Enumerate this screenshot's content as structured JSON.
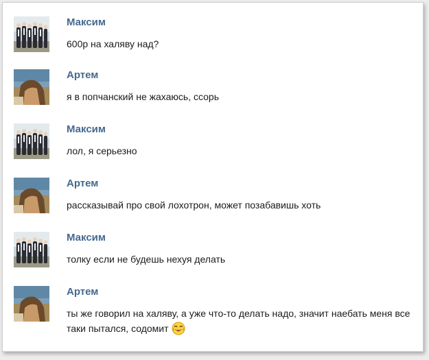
{
  "messages": [
    {
      "author": "Максим",
      "avatar_icon": "group-photo-icon",
      "text": "600р на халяву над?"
    },
    {
      "author": "Артем",
      "avatar_icon": "person-photo-icon",
      "text": "я в попчанский не жахаюсь, ссорь"
    },
    {
      "author": "Максим",
      "avatar_icon": "group-photo-icon",
      "text": "лол, я серьезно"
    },
    {
      "author": "Артем",
      "avatar_icon": "person-photo-icon",
      "text": "рассказывай про свой лохотрон, может позабавишь хоть"
    },
    {
      "author": "Максим",
      "avatar_icon": "group-photo-icon",
      "text": "толку если не будешь нехуя делать"
    },
    {
      "author": "Артем",
      "avatar_icon": "person-photo-icon",
      "text": "ты же говорил на халяву, а уже что-то делать надо, значит наебать меня все таки пытался, содомит",
      "emoji": "laughing-tears-emoji-icon"
    }
  ],
  "colors": {
    "author_name": "#45688e",
    "message_text": "#1a1a1a",
    "background": "#ffffff"
  }
}
